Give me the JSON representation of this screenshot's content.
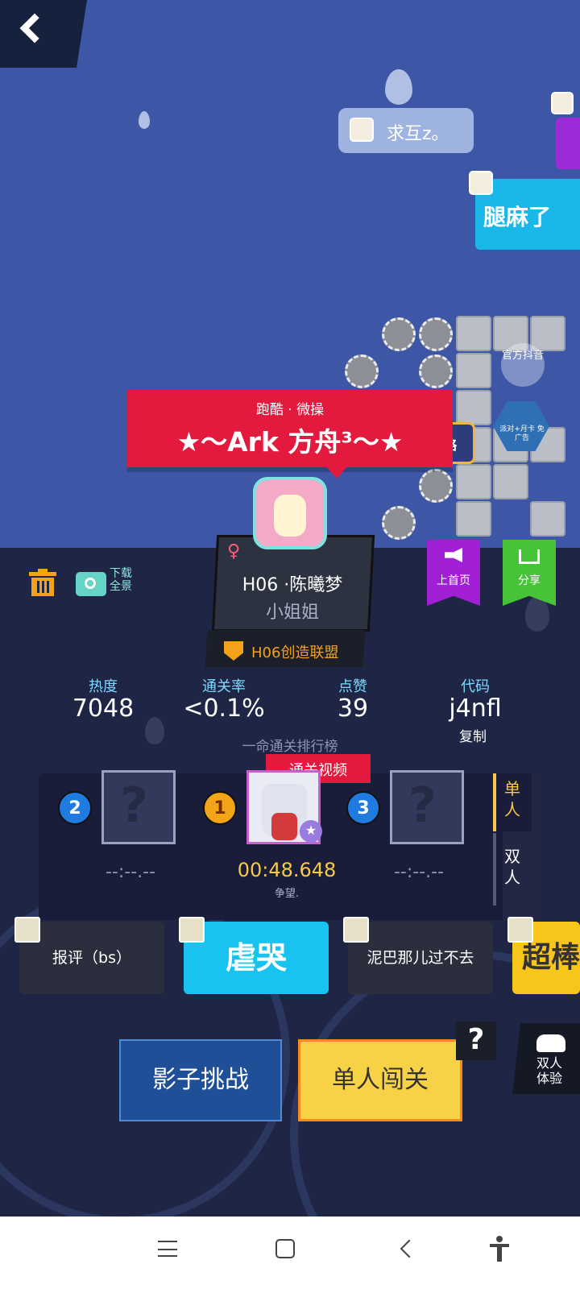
{
  "preview": {
    "chat_bubble": "求互z。",
    "chat_bubble_right": "腿麻了",
    "side_label_official": "官方抖音",
    "guide_label": "攻略",
    "ad_label": "派对+月卡 免广告"
  },
  "banner": {
    "tags": "跑酷 · 微操",
    "level_name": "★～Ark 方舟³～★"
  },
  "author": {
    "gender": "♀",
    "name": "H06 ·陈曦梦",
    "title": "小姐姐",
    "alliance": "H06创造联盟"
  },
  "toolbar": {
    "download_label": "下载全景",
    "promote_label": "上首页",
    "share_label": "分享"
  },
  "stats": {
    "heat_label": "热度",
    "heat_value": "7048",
    "clear_rate_label": "通关率",
    "clear_rate_value": "<0.1%",
    "likes_label": "点赞",
    "likes_value": "39",
    "code_label": "代码",
    "code_value": "j4nfl",
    "copy_label": "复制"
  },
  "ranking": {
    "title": "一命通关排行榜",
    "video_tag": "通关视频",
    "first": {
      "rank": "1",
      "time": "00:48.648",
      "player": "争望."
    },
    "second": {
      "rank": "2",
      "time": "--:--.--"
    },
    "third": {
      "rank": "3",
      "time": "--:--.--"
    },
    "tab_single": "单人",
    "tab_double": "双人"
  },
  "comments": [
    {
      "text": "报评（bs）"
    },
    {
      "text": "虐哭"
    },
    {
      "text": "泥巴那儿过不去"
    },
    {
      "text": "超棒"
    }
  ],
  "actions": {
    "shadow_challenge": "影子挑战",
    "single_play": "单人闯关",
    "help": "?",
    "double_try": "双人体验"
  },
  "colors": {
    "banner_red": "#e31a3e",
    "gold": "#f8d246",
    "accent_blue": "#7fd8ff",
    "promote_purple": "#a11fd4",
    "share_green": "#46c336"
  }
}
